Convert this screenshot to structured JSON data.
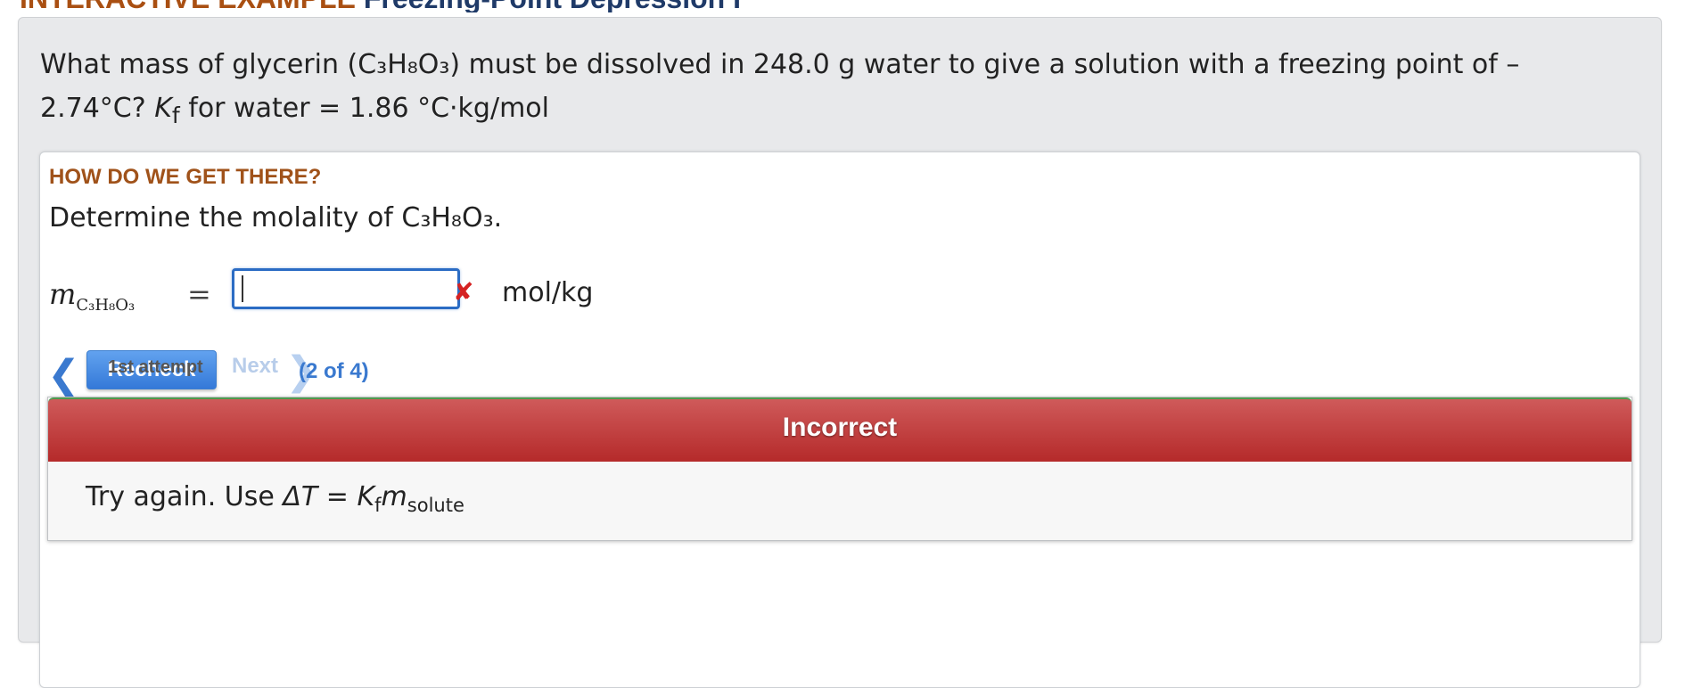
{
  "header": {
    "label": "INTERACTIVE EXAMPLE",
    "title": "Freezing-Point Depression I"
  },
  "question": {
    "line1": "What mass of glycerin (C₃H₈O₃) must be dissolved in 248.0 g water to give a solution with a freezing point of –",
    "line2_prefix": "2.74°C?",
    "kf_symbol": "K",
    "kf_sub": "f",
    "line2_suffix": "for water = 1.86 °C·kg/mol"
  },
  "step": {
    "heading": "HOW DO WE GET THERE?",
    "instruction": "Determine the molality of C₃H₈O₃.",
    "variable": "m",
    "variable_sub": "C₃H₈O₃",
    "equals": "=",
    "input_value": "",
    "input_status": "incorrect",
    "wrong_icon": "✘",
    "unit": "mol/kg"
  },
  "nav": {
    "prev_icon": "❮",
    "recheck_label": "Recheck",
    "next_label": "Next",
    "next_icon": "❯",
    "step_count": "(2 of 4)",
    "attempt": "1st attempt"
  },
  "feedback": {
    "status": "Incorrect",
    "text_prefix": "Try again. Use",
    "formula_lhs": "ΔT",
    "formula_eq": " = ",
    "formula_k": "K",
    "formula_k_sub": "f",
    "formula_m": "m",
    "formula_m_sub": "solute"
  },
  "colors": {
    "header_accent": "#a94f12",
    "primary_blue": "#3479d8",
    "incorrect_red": "#b52a2a",
    "error_icon": "#d52222"
  }
}
